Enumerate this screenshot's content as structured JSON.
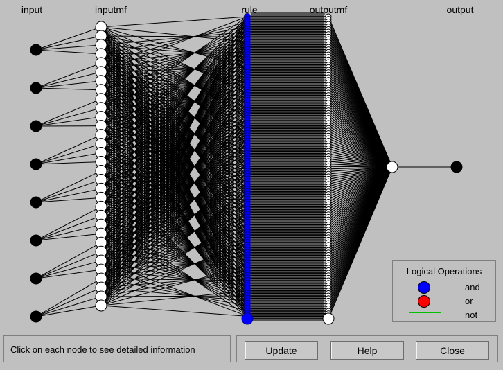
{
  "columns": {
    "input": "input",
    "inputmf": "inputmf",
    "rule": "rule",
    "outputmf": "outputmf",
    "output": "output"
  },
  "network": {
    "input_count": 8,
    "mf_per_input": 4,
    "rule_count": 120,
    "colors": {
      "and": "#0000ff",
      "or": "#ff0000",
      "not": "#00c000",
      "edge": "#000000",
      "background": "#c0c0c0"
    }
  },
  "legend": {
    "title": "Logical Operations",
    "items": [
      {
        "label": "and",
        "symbol": "blue-circle"
      },
      {
        "label": "or",
        "symbol": "red-circle"
      },
      {
        "label": "not",
        "symbol": "green-line"
      }
    ]
  },
  "status": {
    "text": "Click on each node to see detailed information"
  },
  "buttons": {
    "update": "Update",
    "help": "Help",
    "close": "Close"
  }
}
